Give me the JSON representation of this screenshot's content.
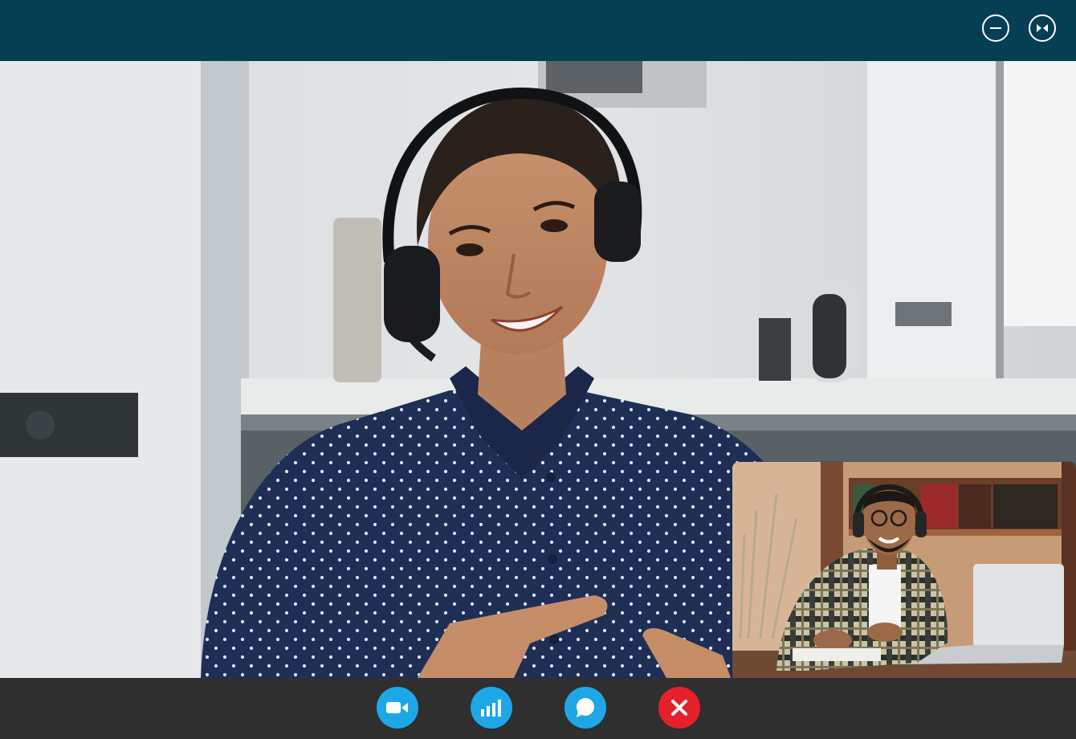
{
  "titlebar": {
    "background": "#063f54",
    "buttons": [
      {
        "icon": "minimize-icon"
      },
      {
        "icon": "collapse-icon"
      }
    ]
  },
  "main_video": {
    "participant": "remote-participant-woman-with-headset"
  },
  "self_view": {
    "participant": "local-participant-man-with-headphones"
  },
  "controls": {
    "background": "#2f2f2f",
    "buttons": [
      {
        "icon": "video-camera-icon",
        "color": "#1ea7e6"
      },
      {
        "icon": "signal-bars-icon",
        "color": "#1ea7e6"
      },
      {
        "icon": "chat-bubble-icon",
        "color": "#1ea7e6"
      },
      {
        "icon": "close-x-icon",
        "color": "#e5202a"
      }
    ]
  }
}
